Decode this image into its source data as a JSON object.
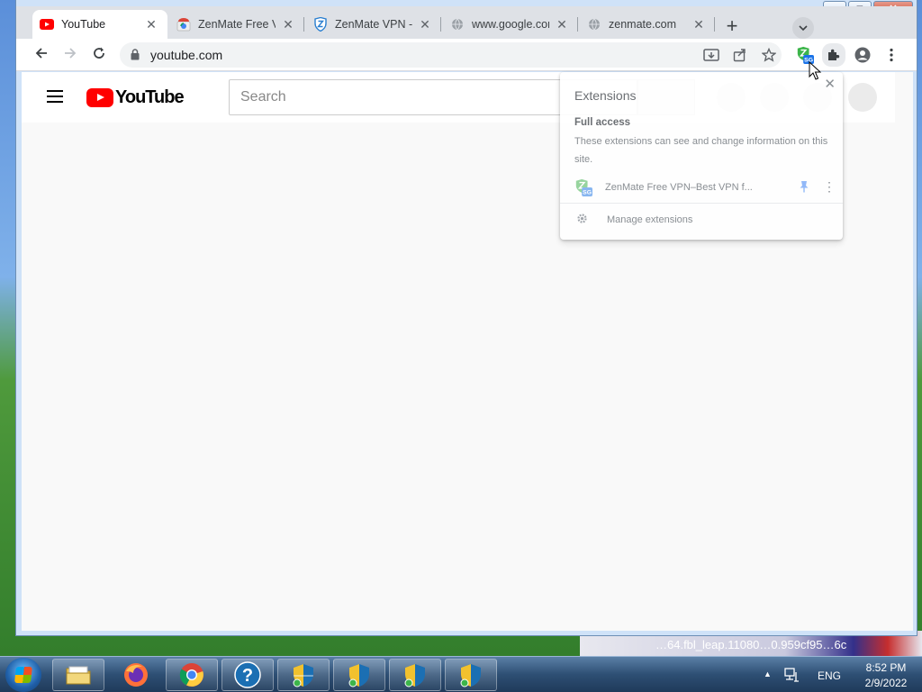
{
  "browser": {
    "window_controls": {
      "minimize": "—",
      "maximize": "□",
      "close": "✕"
    },
    "tabs": [
      {
        "title": "YouTube",
        "icon": "youtube-icon",
        "active": true
      },
      {
        "title": "ZenMate Free VPN",
        "icon": "chrome-webstore-icon",
        "active": false
      },
      {
        "title": "ZenMate VPN - #",
        "icon": "zenmate-shield-icon",
        "active": false
      },
      {
        "title": "www.google.com",
        "icon": "globe-icon",
        "active": false
      },
      {
        "title": "zenmate.com",
        "icon": "globe-icon",
        "active": false
      }
    ],
    "new_tab": "+",
    "tab_search": "⌄",
    "address": {
      "url": "youtube.com"
    },
    "extension_badge": "SG"
  },
  "youtube": {
    "logo_text": "YouTube",
    "search_placeholder": "Search"
  },
  "extensions_popup": {
    "title": "Extensions",
    "close": "✕",
    "section_heading": "Full access",
    "section_description": "These extensions can see and change information on this site.",
    "extension_name": "ZenMate Free VPN–Best VPN f...",
    "extension_badge": "SG",
    "kebab": "⋮",
    "manage_label": "Manage extensions"
  },
  "desktop": {
    "background_text": "…64.fbl_leap.11080…0.959cf95…6c"
  },
  "taskbar": {
    "language": "ENG",
    "time": "8:52 PM",
    "date": "2/9/2022"
  }
}
